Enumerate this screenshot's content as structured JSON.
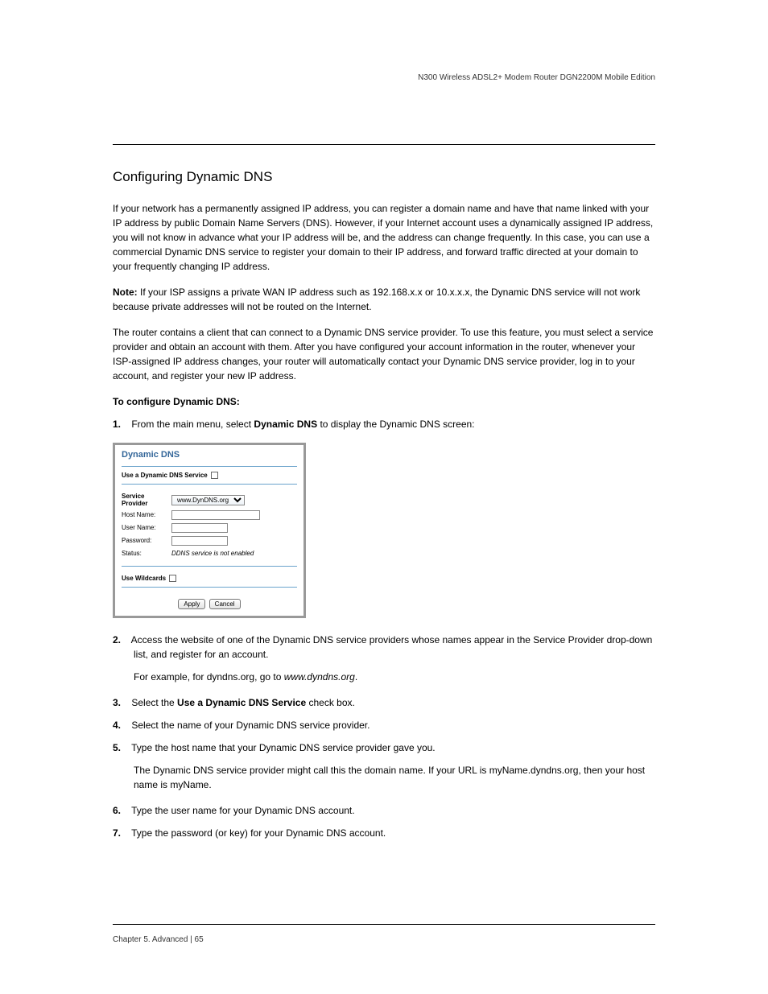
{
  "header": {
    "line1": "N300 Wireless ADSL2+ Modem Router DGN2200M Mobile Edition",
    "line2": ""
  },
  "section_title": "Configuring Dynamic DNS",
  "para1_prefix": "If your network has a permanently assigned IP address, you can register a domain name and have that name linked with your IP address by public Domain Name Servers (DNS). However, if your Internet account uses a dynamically assigned IP address, you will not know in advance what your IP address will be, and the address can change frequently. In this case, you can use a commercial Dynamic DNS service to register your domain to their IP address, and forward traffic directed at your domain to your frequently changing IP address.",
  "para2_prefix": "The router contains a client that can connect to a Dynamic DNS service provider. To use this feature, you must select a service provider and obtain an account with them. After you have configured your account information in the router, whenever your ISP-assigned IP address changes, your router will automatically contact your Dynamic DNS service provider, log in to your account, and register your new IP address.",
  "note": {
    "label": "Note:",
    "text": "If your ISP assigns a private WAN IP address such as 192.168.x.x or 10.x.x.x, the Dynamic DNS service will not work because private addresses will not be routed on the Internet."
  },
  "steps_intro": "To configure Dynamic DNS:",
  "step1": {
    "num": "1.",
    "text_prefix": "From the main menu, select ",
    "text_bold": "Dynamic DNS",
    "text_suffix": " to display the Dynamic DNS screen:"
  },
  "panel": {
    "title": "Dynamic DNS",
    "use_service_label": "Use a Dynamic DNS Service",
    "service_provider_label": "Service Provider",
    "service_provider_value": "www.DynDNS.org",
    "host_name_label": "Host Name:",
    "user_name_label": "User Name:",
    "password_label": "Password:",
    "status_label": "Status:",
    "status_value": "DDNS service is not enabled",
    "wildcards_label": "Use Wildcards",
    "apply": "Apply",
    "cancel": "Cancel"
  },
  "step2": {
    "num": "2.",
    "text": "Access the website of one of the Dynamic DNS service providers whose names appear in the Service Provider drop-down list, and register for an account."
  },
  "step2_example_prefix": "For example, for dyndns.org, go to ",
  "step2_example_link": "www.dyndns.org",
  "step2_example_suffix": ".",
  "step3": {
    "num": "3.",
    "text_prefix": "Select the ",
    "text_bold": "Use a Dynamic DNS Service",
    "text_suffix": " check box."
  },
  "step4": {
    "num": "4.",
    "text": "Select the name of your Dynamic DNS service provider."
  },
  "step5": {
    "num": "5.",
    "text": "Type the host name that your Dynamic DNS service provider gave you."
  },
  "step5_extra": "The Dynamic DNS service provider might call this the domain name. If your URL is myName.dyndns.org, then your host name is myName.",
  "step6": {
    "num": "6.",
    "text": "Type the user name for your Dynamic DNS account."
  },
  "step7": {
    "num": "7.",
    "text": "Type the password (or key) for your Dynamic DNS account."
  },
  "footer": {
    "left": "Chapter 5.  Advanced    |    65",
    "right": ""
  }
}
